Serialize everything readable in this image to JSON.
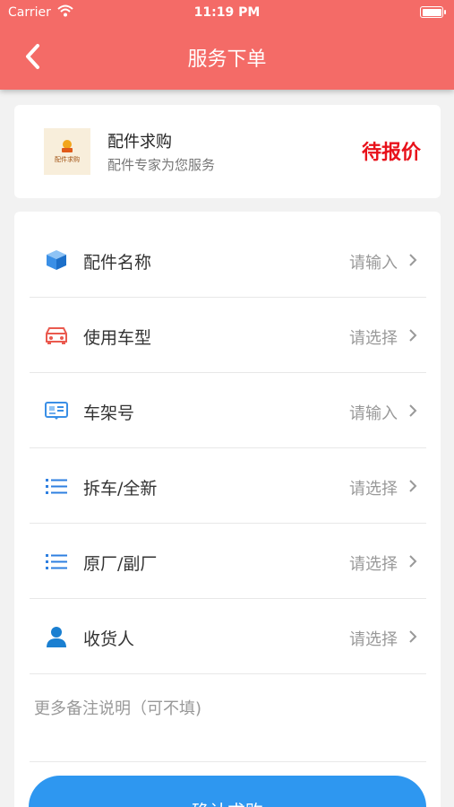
{
  "status_bar": {
    "carrier": "Carrier",
    "time": "11:19 PM"
  },
  "nav": {
    "title": "服务下单"
  },
  "product": {
    "image_label": "配件求购",
    "name": "配件求购",
    "subtitle": "配件专家为您服务",
    "status": "待报价"
  },
  "form": {
    "rows": [
      {
        "label": "配件名称",
        "value": "请输入",
        "icon": "cube-icon"
      },
      {
        "label": "使用车型",
        "value": "请选择",
        "icon": "car-icon"
      },
      {
        "label": "车架号",
        "value": "请输入",
        "icon": "id-card-icon"
      },
      {
        "label": "拆车/全新",
        "value": "请选择",
        "icon": "list-icon"
      },
      {
        "label": "原厂/副厂",
        "value": "请选择",
        "icon": "list-icon"
      },
      {
        "label": "收货人",
        "value": "请选择",
        "icon": "person-icon"
      }
    ],
    "remark_placeholder": "更多备注说明（可不填)"
  },
  "confirm_label": "确认求购",
  "colors": {
    "header": "#f46b67",
    "accent": "#2e97f0",
    "status": "#e8111a"
  }
}
